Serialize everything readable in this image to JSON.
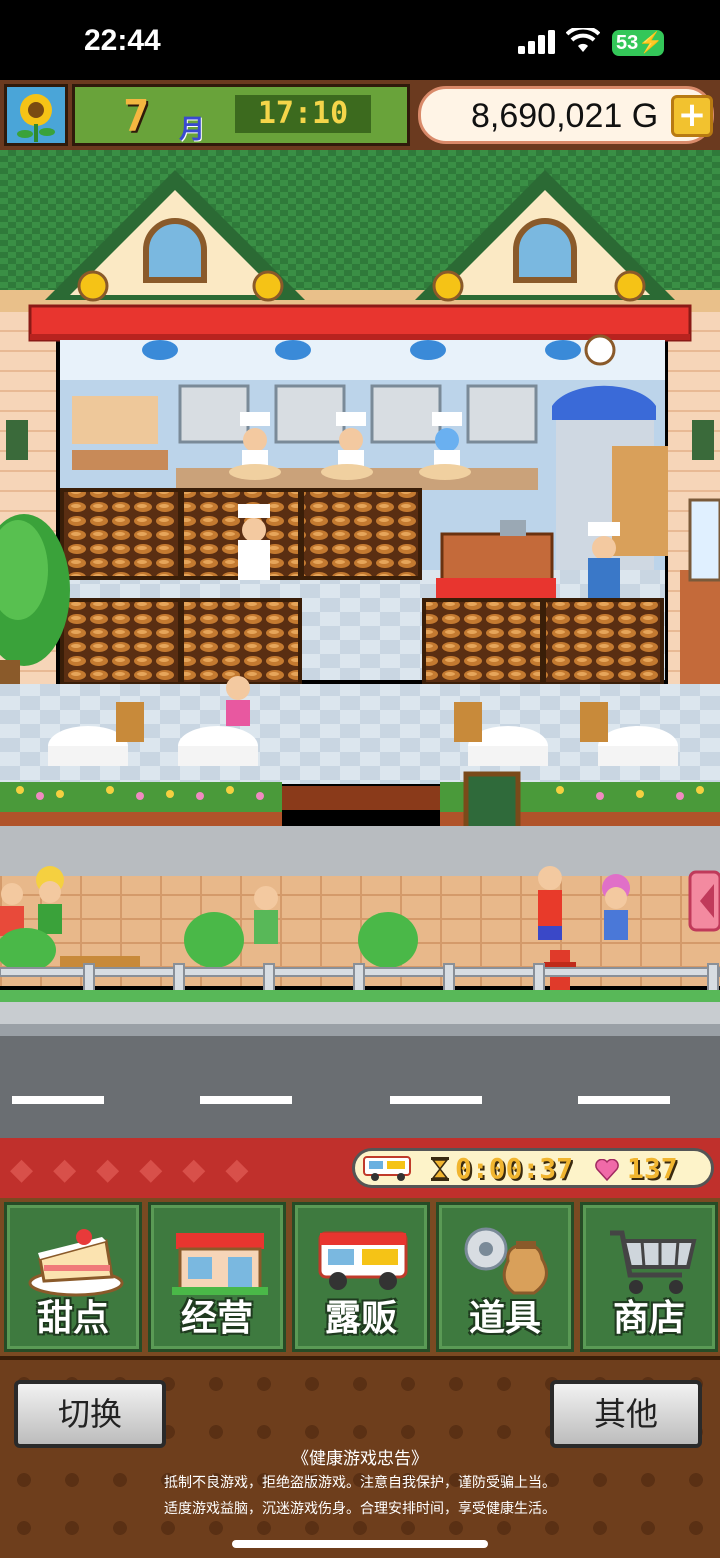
{
  "status_bar": {
    "time": "22:44",
    "battery": "53"
  },
  "hud": {
    "month": "7",
    "month_unit": "月",
    "clock": "17:10",
    "money": "8,690,021",
    "currency": "G",
    "add_label": "+"
  },
  "event_bar": {
    "timer": "0:00:37",
    "hearts": "137"
  },
  "menu": [
    {
      "label": "甜点",
      "icon": "cake-icon"
    },
    {
      "label": "经营",
      "icon": "shop-building-icon"
    },
    {
      "label": "露贩",
      "icon": "food-truck-icon"
    },
    {
      "label": "道具",
      "icon": "items-bag-icon"
    },
    {
      "label": "商店",
      "icon": "shopping-cart-icon"
    }
  ],
  "buttons": {
    "switch_label": "切换",
    "other_label": "其他"
  },
  "notice": {
    "title": "《健康游戏忠告》",
    "line1": "抵制不良游戏，拒绝盗版游戏。注意自我保护，谨防受骗上当。",
    "line2": "适度游戏益脑，沉迷游戏伤身。合理安排时间，享受健康生活。"
  },
  "colors": {
    "hud_green": "#69a33a",
    "awning_red": "#e8352f",
    "roof_green": "#2f7a3a",
    "menu_green": "#3e7a3f",
    "event_red": "#c0302c"
  }
}
